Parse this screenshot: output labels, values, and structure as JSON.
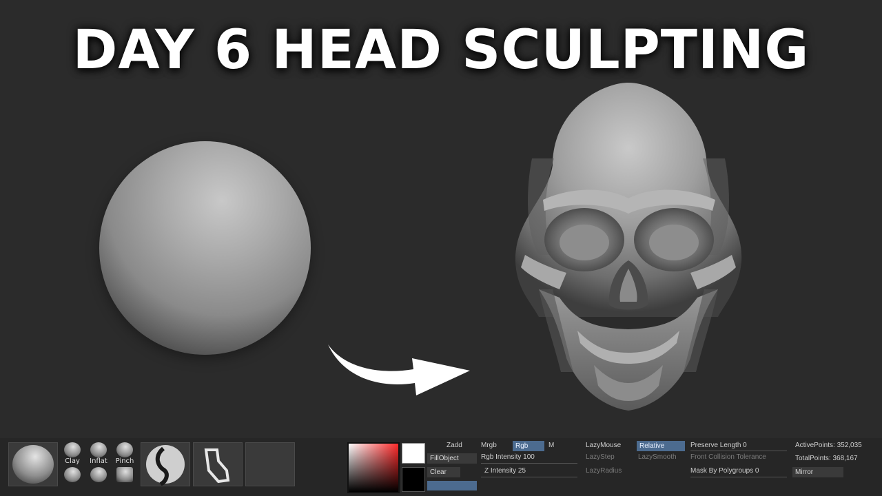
{
  "title": "DAY 6 HEAD SCULPTING",
  "toolbar": {
    "brushes": {
      "clay": "Clay",
      "inflat": "Inflat",
      "pinch": "Pinch"
    },
    "zadd": "Zadd",
    "mrgb": "Mrgb",
    "rgb": "Rgb",
    "m": "M",
    "fill_object": "FillObject",
    "clear": "Clear",
    "rgb_intensity": "Rgb Intensity 100",
    "z_intensity": "Z Intensity 25",
    "lazy_mouse": "LazyMouse",
    "relative": "Relative",
    "lazy_step": "LazyStep",
    "lazy_smooth": "LazySmooth",
    "lazy_radius": "LazyRadius",
    "preserve_length": "Preserve Length 0",
    "front_collision": "Front Collision Tolerance",
    "mask_by_polygroups": "Mask By Polygroups 0",
    "active_points": "ActivePoints: 352,035",
    "total_points": "TotalPoints: 368,167",
    "mirror": "Mirror"
  },
  "colors": {
    "background": "#2b2b2b",
    "title": "#ffffff",
    "active_button": "#4c6b8f"
  }
}
